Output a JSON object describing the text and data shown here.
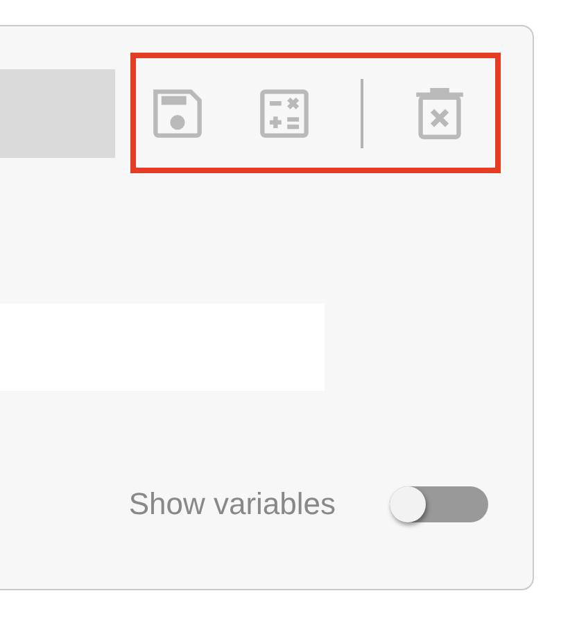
{
  "toolbar": {
    "highlighted": true,
    "buttons": [
      {
        "kind": "save",
        "disabled": true
      },
      {
        "kind": "calculator",
        "disabled": true
      },
      {
        "kind": "separator"
      },
      {
        "kind": "delete",
        "disabled": true
      }
    ]
  },
  "toggle": {
    "label": "Show variables",
    "on": false
  }
}
